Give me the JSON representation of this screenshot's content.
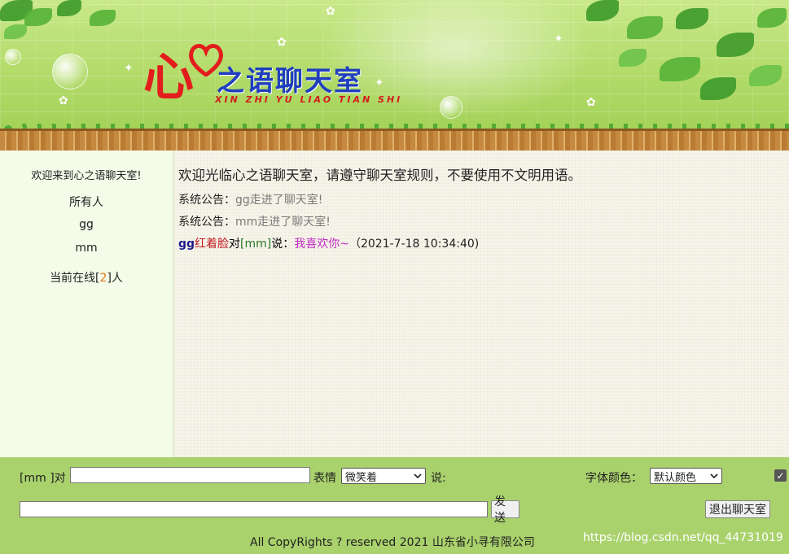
{
  "header": {
    "logo_char": "心",
    "logo_title": "之语聊天室",
    "logo_pinyin": "XIN ZHI YU LIAO TIAN SHI"
  },
  "sidebar": {
    "welcome": "欢迎来到心之语聊天室!",
    "users": [
      "所有人",
      "gg",
      "mm"
    ],
    "online_prefix": "当前在线[",
    "online_count": "2",
    "online_suffix": "]人"
  },
  "chat": {
    "welcome": "欢迎光临心之语聊天室，请遵守聊天室规则，不要使用不文明用语。",
    "notices": [
      {
        "label": "系统公告：",
        "text": "gg走进了聊天室!"
      },
      {
        "label": "系统公告：",
        "text": "mm走进了聊天室!"
      }
    ],
    "message": {
      "from": "gg",
      "expression": "红着脸",
      "dui": "对",
      "to": "[mm]",
      "shuo": "说：",
      "text": "我喜欢你~",
      "time": "（2021-7-18 10:34:40)"
    }
  },
  "controls": {
    "target_label": "[mm ]对",
    "target_value": "",
    "expression_label": "表情",
    "expression_selected": "微笑着",
    "say_label": "说:",
    "font_color_label": "字体颜色：",
    "font_color_selected": "默认颜色",
    "checkbox_checked": true,
    "message_value": "",
    "send_label": "发送",
    "exit_label": "退出聊天室"
  },
  "footer": {
    "copyright": "All CopyRights ? reserved 2021 山东省小寻有限公司",
    "watermark": "https://blog.csdn.net/qq_44731019"
  },
  "colors": {
    "sender": "#1a1a8c",
    "expression": "#c0181f",
    "recipient": "#2a7a2a",
    "message": "#c12bc4",
    "notice": "#7a7a7a",
    "online_count": "#e07b1a",
    "bottom_bar": "#a9d26c"
  }
}
